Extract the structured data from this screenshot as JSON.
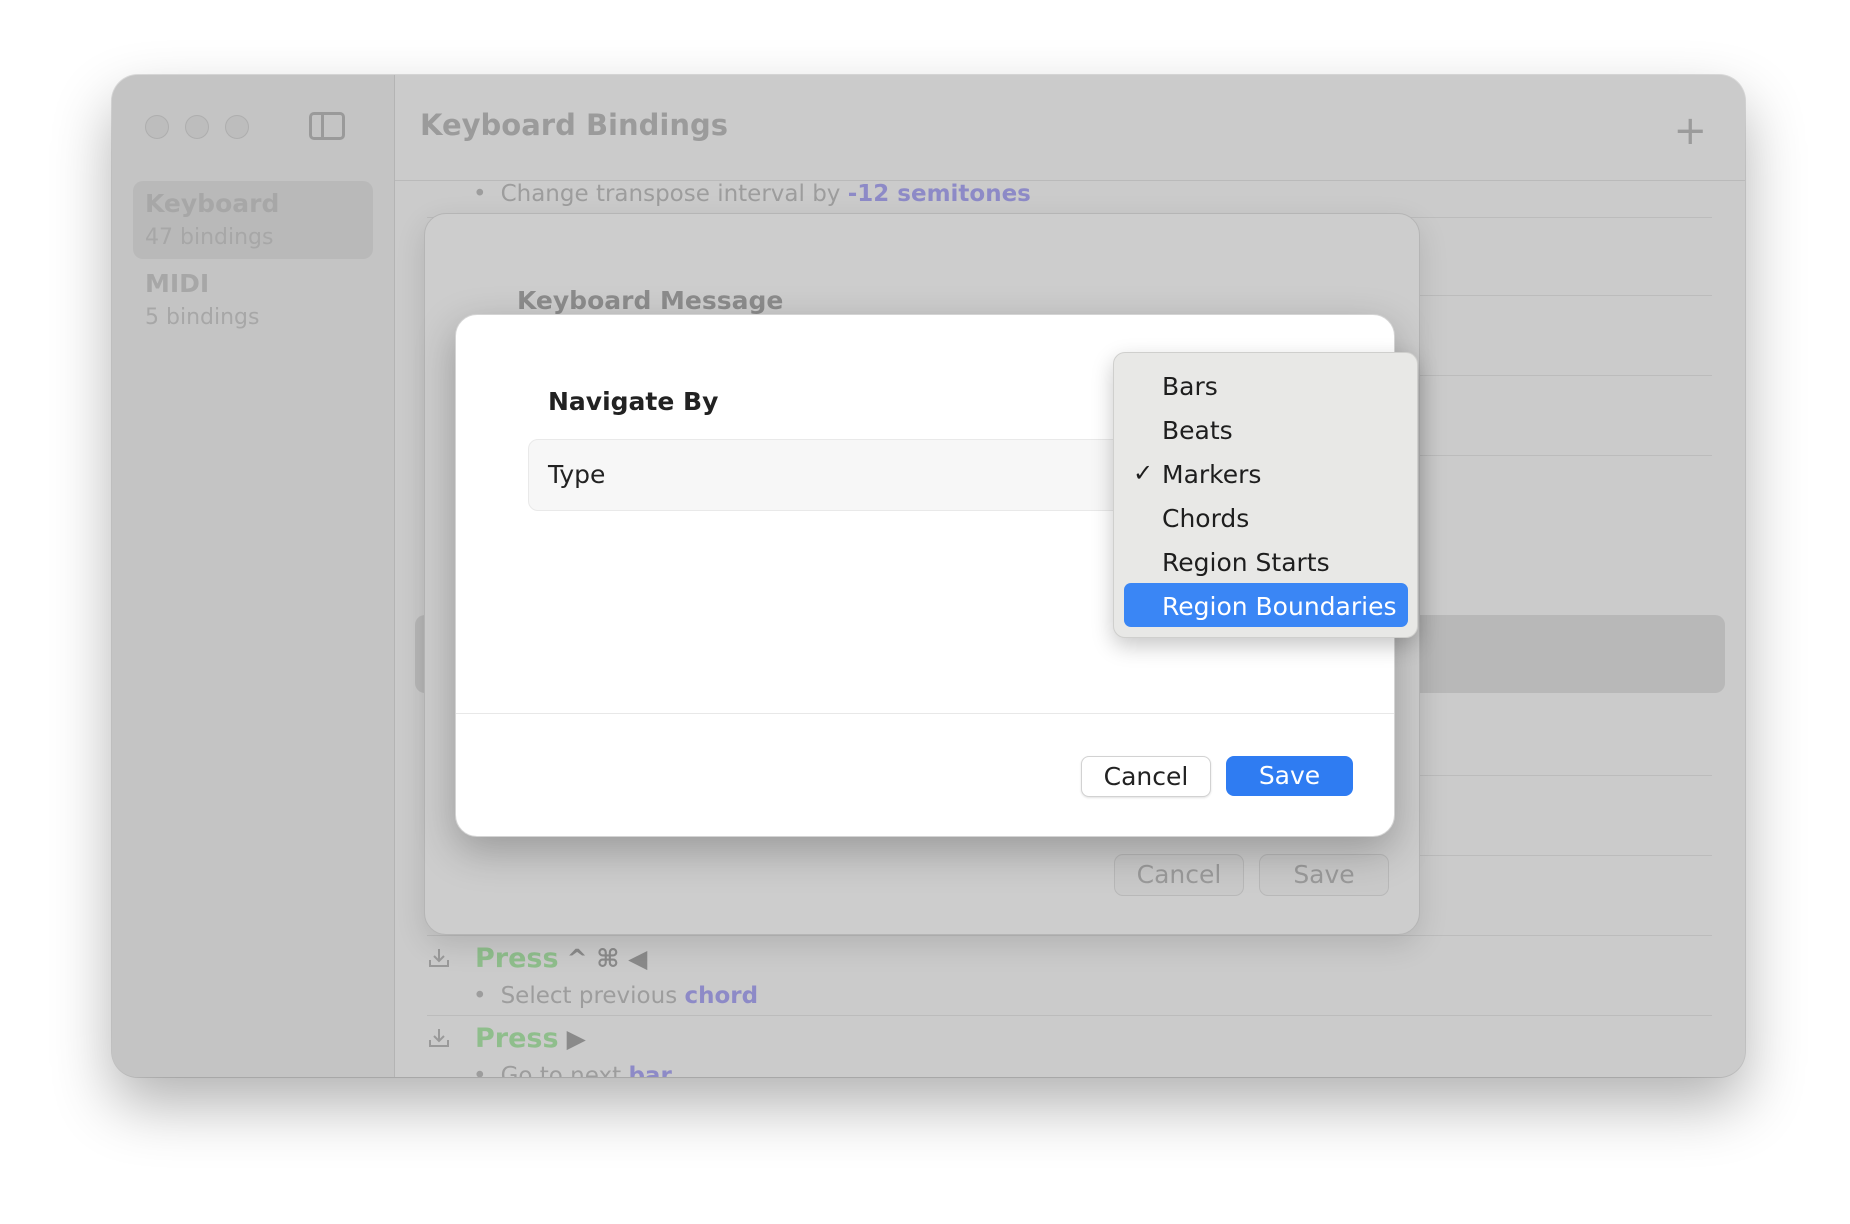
{
  "sidebar": {
    "items": [
      {
        "title": "Keyboard",
        "subtitle": "47 bindings",
        "selected": true
      },
      {
        "title": "MIDI",
        "subtitle": "5 bindings",
        "selected": false
      }
    ]
  },
  "header": {
    "title": "Keyboard Bindings",
    "add_icon": "+"
  },
  "list": {
    "top_row": {
      "text": "Change transpose interval by ",
      "highlight": "-12 semitones"
    },
    "rows": [
      {
        "press": "Press",
        "keys": "^ ⌘ ◀",
        "text": "Select previous ",
        "highlight": "chord"
      },
      {
        "press": "Press",
        "keys": "▶",
        "text": "Go to next ",
        "highlight": "bar"
      }
    ]
  },
  "sheet": {
    "title": "Keyboard Message",
    "cancel_label": "Cancel",
    "save_label": "Save"
  },
  "dialog": {
    "title": "Navigate By",
    "type_label": "Type",
    "cancel_label": "Cancel",
    "save_label": "Save"
  },
  "menu": {
    "items": [
      {
        "label": "Bars"
      },
      {
        "label": "Beats"
      },
      {
        "label": "Markers",
        "checked": true
      },
      {
        "label": "Chords"
      },
      {
        "label": "Region Starts"
      },
      {
        "label": "Region Boundaries",
        "highlighted": true
      }
    ],
    "check_glyph": "✓"
  },
  "colors": {
    "accent": "#2f7cf2",
    "menu_highlight": "#3a86f5",
    "press_green": "#8fbe8c",
    "link_purple": "#8d8ac7"
  }
}
